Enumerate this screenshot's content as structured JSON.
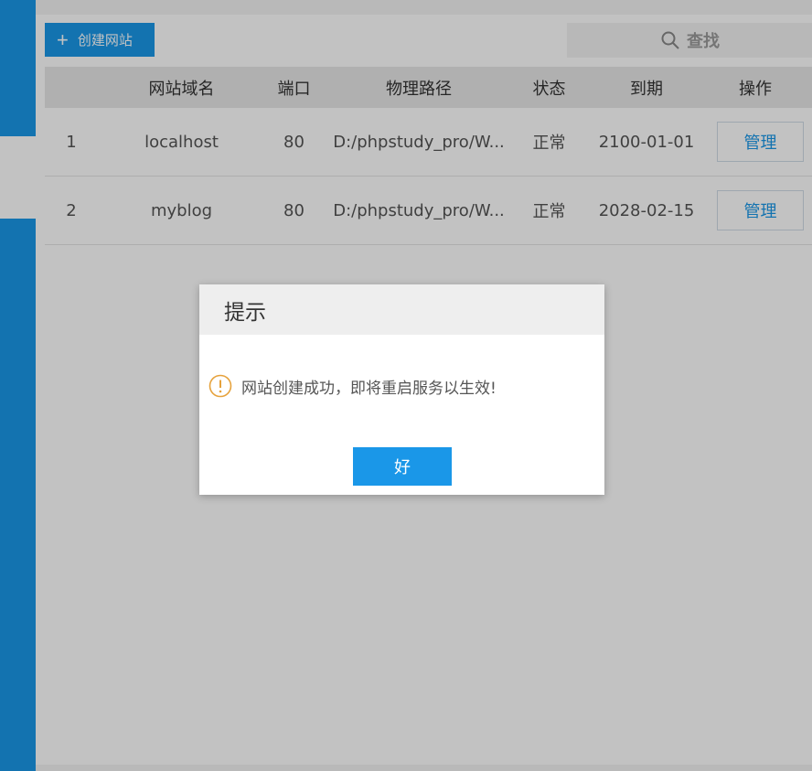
{
  "toolbar": {
    "create_label": "创建网站",
    "search_label": "查找"
  },
  "table": {
    "headers": [
      "",
      "网站域名",
      "端口",
      "物理路径",
      "状态",
      "到期",
      "操作"
    ],
    "rows": [
      {
        "index": "1",
        "domain": "localhost",
        "port": "80",
        "path": "D:/phpstudy_pro/W...",
        "status": "正常",
        "expiry": "2100-01-01",
        "action": "管理"
      },
      {
        "index": "2",
        "domain": "myblog",
        "port": "80",
        "path": "D:/phpstudy_pro/W...",
        "status": "正常",
        "expiry": "2028-02-15",
        "action": "管理"
      }
    ]
  },
  "dialog": {
    "title": "提示",
    "message": "网站创建成功，即将重启服务以生效!",
    "ok_label": "好"
  },
  "colors": {
    "accent": "#1a97e8",
    "warning": "#e6a23c"
  }
}
